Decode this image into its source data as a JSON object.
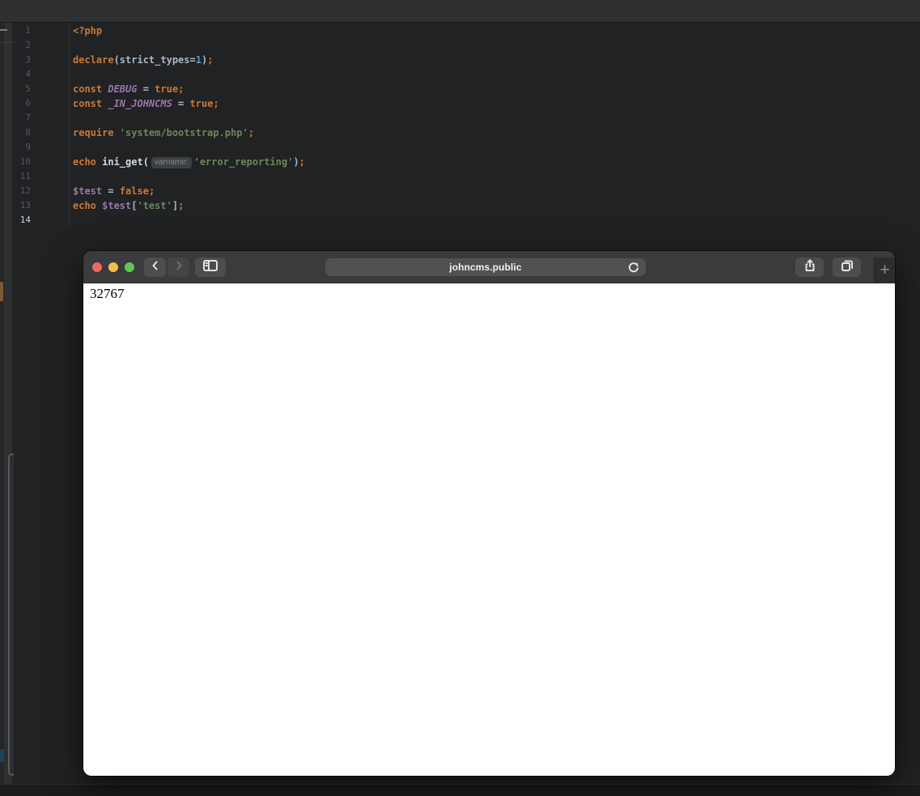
{
  "editor": {
    "active_line": 14,
    "total_lines": 14,
    "lines": [
      {
        "n": 1,
        "tokens": [
          [
            "<?php",
            "keyword"
          ]
        ]
      },
      {
        "n": 2,
        "tokens": []
      },
      {
        "n": 3,
        "tokens": [
          [
            "declare",
            "keyword"
          ],
          [
            "(strict_types=",
            "plain"
          ],
          [
            "1",
            "number"
          ],
          [
            ")",
            "plain"
          ],
          [
            ";",
            "semi"
          ]
        ]
      },
      {
        "n": 4,
        "tokens": []
      },
      {
        "n": 5,
        "tokens": [
          [
            "const ",
            "keyword"
          ],
          [
            "DEBUG",
            "const"
          ],
          [
            " = ",
            "plain"
          ],
          [
            "true",
            "keyword"
          ],
          [
            ";",
            "semi"
          ]
        ]
      },
      {
        "n": 6,
        "tokens": [
          [
            "const ",
            "keyword"
          ],
          [
            "_IN_JOHNCMS",
            "const"
          ],
          [
            " = ",
            "plain"
          ],
          [
            "true",
            "keyword"
          ],
          [
            ";",
            "semi"
          ]
        ]
      },
      {
        "n": 7,
        "tokens": []
      },
      {
        "n": 8,
        "tokens": [
          [
            "require ",
            "keyword"
          ],
          [
            "'system/bootstrap.php'",
            "string"
          ],
          [
            ";",
            "semi"
          ]
        ]
      },
      {
        "n": 9,
        "tokens": []
      },
      {
        "n": 10,
        "tokens": [
          [
            "echo ",
            "keyword"
          ],
          [
            "ini_get(",
            "func"
          ],
          [
            "varname:",
            "inlay"
          ],
          [
            "'error_reporting'",
            "string"
          ],
          [
            ")",
            "plain"
          ],
          [
            ";",
            "semi"
          ]
        ]
      },
      {
        "n": 11,
        "tokens": []
      },
      {
        "n": 12,
        "tokens": [
          [
            "$test",
            "var"
          ],
          [
            " = ",
            "plain"
          ],
          [
            "false",
            "keyword"
          ],
          [
            ";",
            "semi"
          ]
        ]
      },
      {
        "n": 13,
        "tokens": [
          [
            "echo ",
            "keyword"
          ],
          [
            "$test",
            "var"
          ],
          [
            "[",
            "plain"
          ],
          [
            "'test'",
            "string"
          ],
          [
            "]",
            "plain"
          ],
          [
            ";",
            "semi"
          ]
        ]
      },
      {
        "n": 14,
        "tokens": []
      }
    ]
  },
  "browser": {
    "url": "johncms.public",
    "page_text": "32767",
    "new_tab_label": "+",
    "traffic_lights": [
      "close",
      "minimize",
      "zoom"
    ]
  },
  "colors": {
    "editor_background": "#212224",
    "keyword": "#cc7832",
    "string": "#6a8759",
    "number": "#6897bb",
    "constant": "#9876aa",
    "toolbar": "#3a3b3d",
    "traffic_red": "#ed6a5e",
    "traffic_yellow": "#f4bf4f",
    "traffic_green": "#61c554"
  }
}
